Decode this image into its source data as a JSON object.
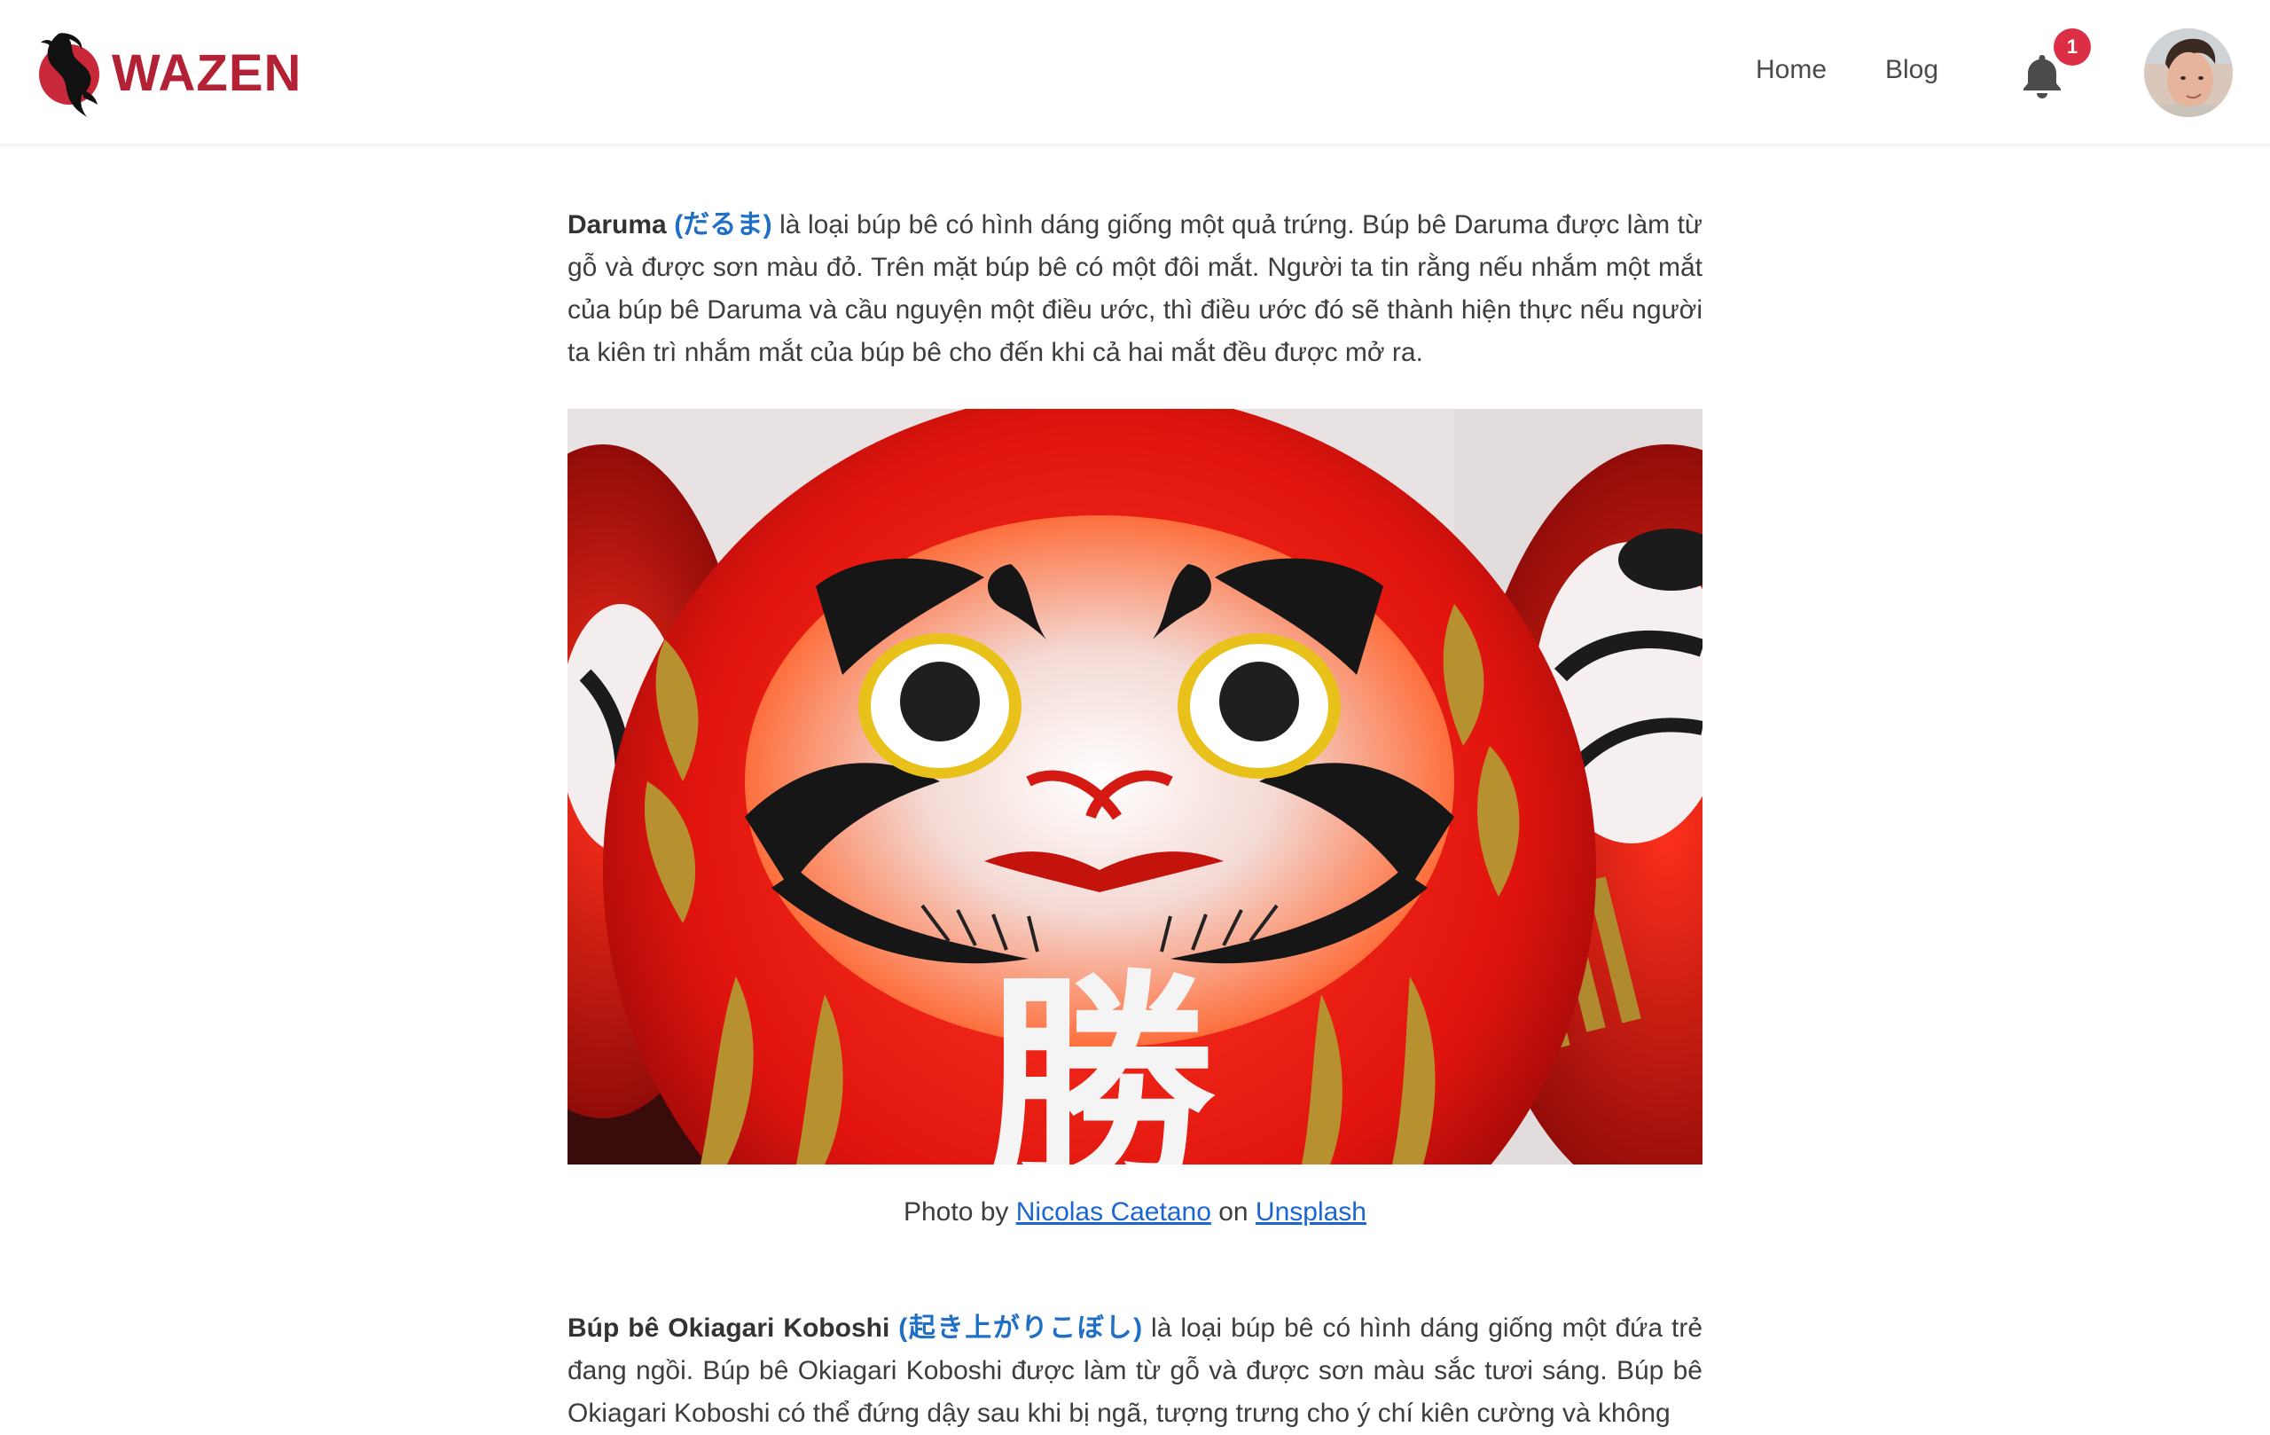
{
  "header": {
    "brand": "WAZEN",
    "nav": [
      {
        "label": "Home"
      },
      {
        "label": "Blog"
      }
    ],
    "notifications": {
      "count": "1",
      "icon": "bell-icon"
    },
    "avatar_icon": "user-avatar"
  },
  "article": {
    "p1": {
      "term": "Daruma",
      "jp": "(だるま)",
      "text": " là loại búp bê có hình dáng giống một quả trứng. Búp bê Daruma được làm từ gỗ và được sơn màu đỏ. Trên mặt búp bê có một đôi mắt. Người ta tin rằng nếu nhắm một mắt của búp bê Daruma và cầu nguyện một điều ước, thì điều ước đó sẽ thành hiện thực nếu người ta kiên trì nhắm mắt của búp bê cho đến khi cả hai mắt đều được mở ra."
    },
    "photo_glyph": "勝",
    "caption": {
      "prefix": "Photo by ",
      "author": "Nicolas Caetano",
      "middle": " on ",
      "source": "Unsplash"
    },
    "p2": {
      "term": "Búp bê Okiagari Koboshi",
      "jp": "(起き上がりこぼし)",
      "text": " là loại búp bê có hình dáng giống một đứa trẻ đang ngồi. Búp bê Okiagari Koboshi được làm từ gỗ và được sơn màu sắc tươi sáng. Búp bê Okiagari Koboshi có thể đứng dậy sau khi bị ngã, tượng trưng cho ý chí kiên cường và không"
    }
  },
  "colors": {
    "brand": "#b22234",
    "link": "#1a66d0",
    "badge": "#dc2f45"
  }
}
